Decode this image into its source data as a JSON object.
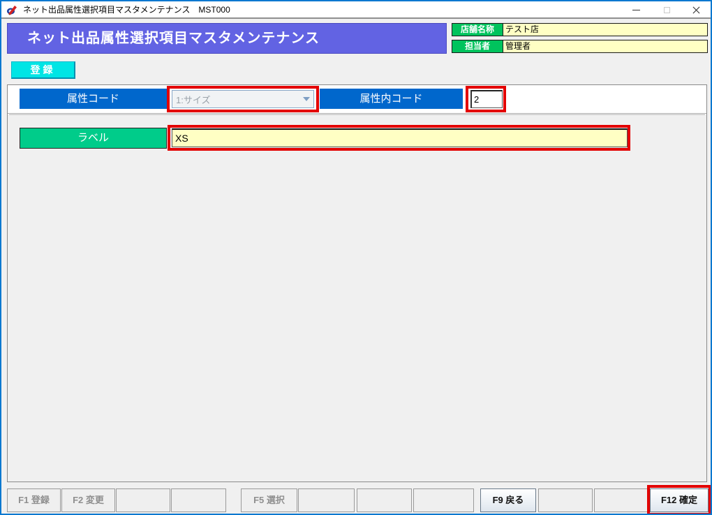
{
  "window": {
    "title": "ネット出品属性選択項目マスタメンテナンス　MST000"
  },
  "header": {
    "banner_title": "ネット出品属性選択項目マスタメンテナンス",
    "store": {
      "label": "店舗名称",
      "value": "テスト店"
    },
    "person": {
      "label": "担当者",
      "value": "管理者"
    }
  },
  "mode_tab": {
    "label": "登録"
  },
  "form": {
    "attribute_code": {
      "label": "属性コード",
      "value": "1:サイズ",
      "disabled": true
    },
    "attribute_inner_code": {
      "label": "属性内コード",
      "value": "2"
    },
    "label_field": {
      "label": "ラベル",
      "value": "XS"
    }
  },
  "function_bar": {
    "buttons": [
      {
        "label": "F1 登録",
        "enabled": false
      },
      {
        "label": "F2 変更",
        "enabled": false
      },
      {
        "label": "",
        "enabled": false
      },
      {
        "label": "",
        "enabled": false
      },
      {
        "label": "F5 選択",
        "enabled": false
      },
      {
        "label": "",
        "enabled": false
      },
      {
        "label": "",
        "enabled": false
      },
      {
        "label": "",
        "enabled": false
      },
      {
        "label": "F9 戻る",
        "enabled": true
      },
      {
        "label": "",
        "enabled": false
      },
      {
        "label": "",
        "enabled": false
      },
      {
        "label": "F12 確定",
        "enabled": true
      }
    ]
  },
  "colors": {
    "window_border": "#0a78d0",
    "banner_blue": "#6263e3",
    "label_blue": "#0067cc",
    "label_green": "#00c35d",
    "label_green_emerald": "#00cc8a",
    "field_yellow": "#ffffc4",
    "tab_cyan": "#00e5e5",
    "highlight_red": "#e30000"
  }
}
